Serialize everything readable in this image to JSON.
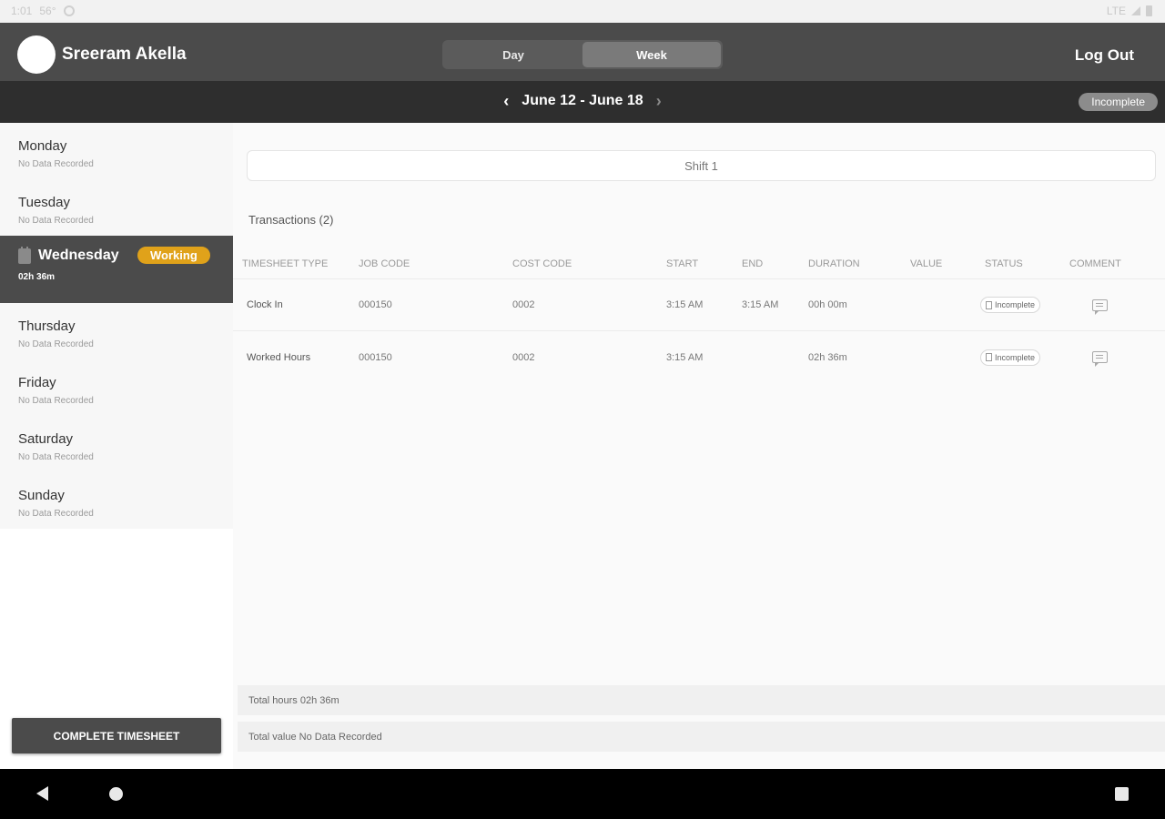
{
  "status_bar": {
    "time": "1:01",
    "left_extra": "56°",
    "network": "LTE"
  },
  "header": {
    "user_name": "Sreeram Akella",
    "view_toggle": [
      "Day",
      "Week"
    ],
    "active_view": "Week",
    "logout_label": "Log Out"
  },
  "date_bar": {
    "range": "June 12 - June 18",
    "status": "Incomplete"
  },
  "sidebar": {
    "days": [
      {
        "name": "Monday",
        "sub": "No Data Recorded"
      },
      {
        "name": "Tuesday",
        "sub": "No Data Recorded"
      },
      {
        "name": "Wednesday",
        "sub": "02h 36m",
        "badge": "Working"
      },
      {
        "name": "Thursday",
        "sub": "No Data Recorded"
      },
      {
        "name": "Friday",
        "sub": "No Data Recorded"
      },
      {
        "name": "Saturday",
        "sub": "No Data Recorded"
      },
      {
        "name": "Sunday",
        "sub": "No Data Recorded"
      }
    ],
    "complete_button": "COMPLETE TIMESHEET"
  },
  "main": {
    "shift_label": "Shift 1",
    "transactions_title": "Transactions (2)",
    "columns": [
      "TIMESHEET TYPE",
      "JOB CODE",
      "COST CODE",
      "START",
      "END",
      "DURATION",
      "VALUE",
      "STATUS",
      "COMMENT"
    ],
    "rows": [
      {
        "type": "Clock In",
        "job_code": "000150",
        "cost_code": "0002",
        "start": "3:15 AM",
        "end": "3:15 AM",
        "duration": "00h 00m",
        "value": "",
        "status": "Incomplete"
      },
      {
        "type": "Worked Hours",
        "job_code": "000150",
        "cost_code": "0002",
        "start": "3:15 AM",
        "end": "",
        "duration": "02h 36m",
        "value": "",
        "status": "Incomplete"
      }
    ],
    "total_hours": "Total hours 02h 36m",
    "total_value": "Total value No Data Recorded"
  },
  "colors": {
    "header_bg": "#4b4b4b",
    "datebar_bg": "#2e2e2e",
    "working_badge": "#e0a21a"
  }
}
